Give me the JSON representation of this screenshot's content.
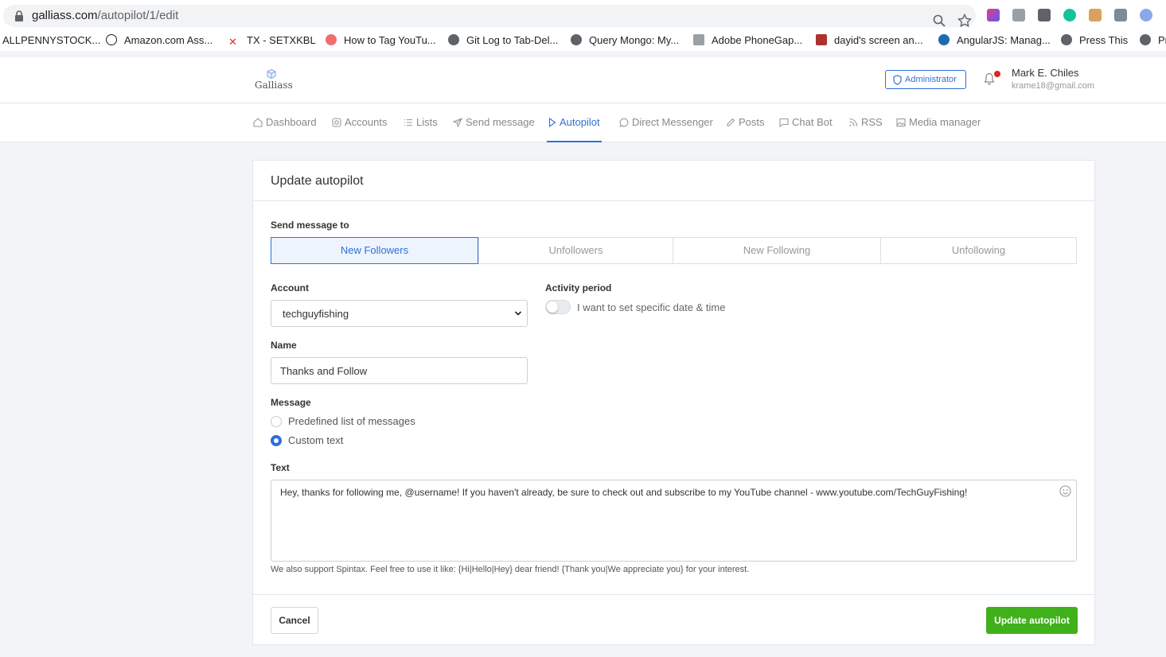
{
  "browser": {
    "url_host": "galliass.com",
    "url_path": "/autopilot/1/edit",
    "bookmarks": [
      {
        "label": "ALLPENNYSTOCK...",
        "icon": "none"
      },
      {
        "label": "Amazon.com Ass...",
        "icon": "amazon-icon"
      },
      {
        "label": "TX - SETXKBL",
        "icon": "red-x-icon"
      },
      {
        "label": "How to Tag YouTu...",
        "icon": "pink-blob-icon"
      },
      {
        "label": "Git Log to Tab-Del...",
        "icon": "globe-icon"
      },
      {
        "label": "Query Mongo: My...",
        "icon": "globe-icon"
      },
      {
        "label": "Adobe PhoneGap...",
        "icon": "phonegap-icon"
      },
      {
        "label": "dayid's screen an...",
        "icon": "person-icon"
      },
      {
        "label": "AngularJS: Manag...",
        "icon": "drupal-icon"
      },
      {
        "label": "Press This",
        "icon": "globe-icon"
      },
      {
        "label": "Pr",
        "icon": "globe-icon"
      }
    ]
  },
  "header": {
    "logo_text": "Galliass",
    "admin_label": "Administrator",
    "user_name": "Mark E. Chiles",
    "user_email": "krame18@gmail.com"
  },
  "nav": {
    "items": [
      {
        "label": "Dashboard",
        "icon": "home-icon"
      },
      {
        "label": "Accounts",
        "icon": "instagram-icon"
      },
      {
        "label": "Lists",
        "icon": "list-icon"
      },
      {
        "label": "Send message",
        "icon": "send-icon"
      },
      {
        "label": "Autopilot",
        "icon": "play-icon",
        "active": true
      },
      {
        "label": "Direct Messenger",
        "icon": "chat-bubble-icon"
      },
      {
        "label": "Posts",
        "icon": "pencil-icon"
      },
      {
        "label": "Chat Bot",
        "icon": "message-square-icon"
      },
      {
        "label": "RSS",
        "icon": "rss-icon"
      },
      {
        "label": "Media manager",
        "icon": "image-icon"
      }
    ]
  },
  "form": {
    "title": "Update autopilot",
    "send_to_label": "Send message to",
    "send_to_options": [
      "New Followers",
      "Unfollowers",
      "New Following",
      "Unfollowing"
    ],
    "send_to_selected": "New Followers",
    "account_label": "Account",
    "account_value": "techguyfishing",
    "activity_label": "Activity period",
    "activity_toggle_label": "I want to set specific date & time",
    "activity_toggle_on": false,
    "name_label": "Name",
    "name_value": "Thanks and Follow",
    "message_label": "Message",
    "message_options": [
      "Predefined list of messages",
      "Custom text"
    ],
    "message_selected": "Custom text",
    "text_label": "Text",
    "text_value": "Hey, thanks for following me, @username! If you haven't already, be sure to check out and subscribe to my YouTube channel - www.youtube.com/TechGuyFishing!",
    "spintax_hint": "We also support Spintax. Feel free to use it like: {Hi|Hello|Hey} dear friend! {Thank you|We appreciate you} for your interest.",
    "cancel_label": "Cancel",
    "submit_label": "Update autopilot"
  },
  "colors": {
    "accent": "#2e6fdb",
    "submit": "#40b11b",
    "notification": "#e02424"
  }
}
